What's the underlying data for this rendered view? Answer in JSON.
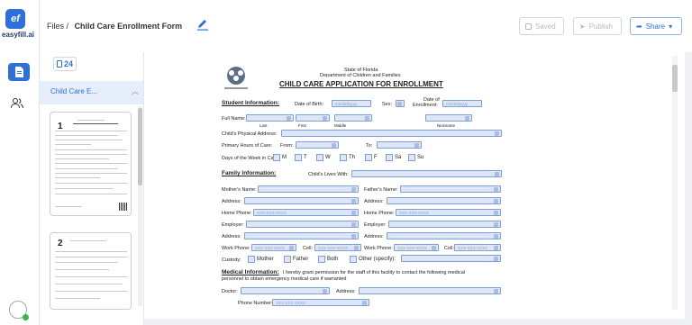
{
  "app": {
    "logo_text": "ef",
    "brand": "easyfill.ai"
  },
  "header": {
    "breadcrumb_root": "Files",
    "separator": "/",
    "title": "Child Care Enrollment Form",
    "saved_label": "Saved",
    "publish_label": "Publish",
    "share_label": "Share"
  },
  "sidebar": {
    "page_count": "24",
    "doc_name": "Child Care E..."
  },
  "thumbnails": [
    {
      "page": "1"
    },
    {
      "page": "2"
    }
  ],
  "form": {
    "state": "State of Florida",
    "dept": "Department of Children and Families",
    "title": "CHILD CARE APPLICATION FOR ENROLLMENT",
    "student_heading": "Student Information:",
    "dob_label": "Date of Birth:",
    "dob_placeholder": "mm/dd/yyyy",
    "sex_label": "Sex:",
    "enroll_label_1": "Date of",
    "enroll_label_2": "Enrollment:",
    "enroll_placeholder": "mm/dd/yyyy",
    "fullname_label": "Full Name:",
    "name_parts": [
      "Last",
      "First",
      "Middle",
      "Nickname"
    ],
    "address_label": "Child's Physical Address:",
    "hours_label": "Primary Hours of Care:",
    "from_label": "From:",
    "to_label": "To:",
    "days_label": "Days of the Week in Care:",
    "days": [
      "M",
      "T",
      "W",
      "Th",
      "F",
      "Sa",
      "Su"
    ],
    "family_heading": "Family Information:",
    "lives_with_label": "Child's Lives With:",
    "mother_name": "Mother's Name:",
    "father_name": "Father's Name:",
    "address": "Address:",
    "home_phone": "Home Phone:",
    "employer": "Employer:",
    "work_phone": "Work Phone:",
    "cell": "Cell:",
    "phone_placeholder": "XXX-XXX-XXXX",
    "cell_placeholder": "XXX-XXX-XXXX",
    "custody_label": "Custody:",
    "custody_options": [
      "Mother",
      "Father",
      "Both",
      "Other (specify):"
    ],
    "medical_heading": "Medical Information:",
    "medical_text_1": "I hereby grant permission for the staff of this facility to contact the following medical",
    "medical_text_2": "personnel to obtain emergency medical care if warranted",
    "doctor_label": "Doctor:",
    "doctor_address": "Address:",
    "phone_number": "Phone Number:"
  },
  "colors": {
    "accent": "#2e6fd8",
    "field_bg": "#dde6f7",
    "field_border": "#7f9fd6"
  }
}
